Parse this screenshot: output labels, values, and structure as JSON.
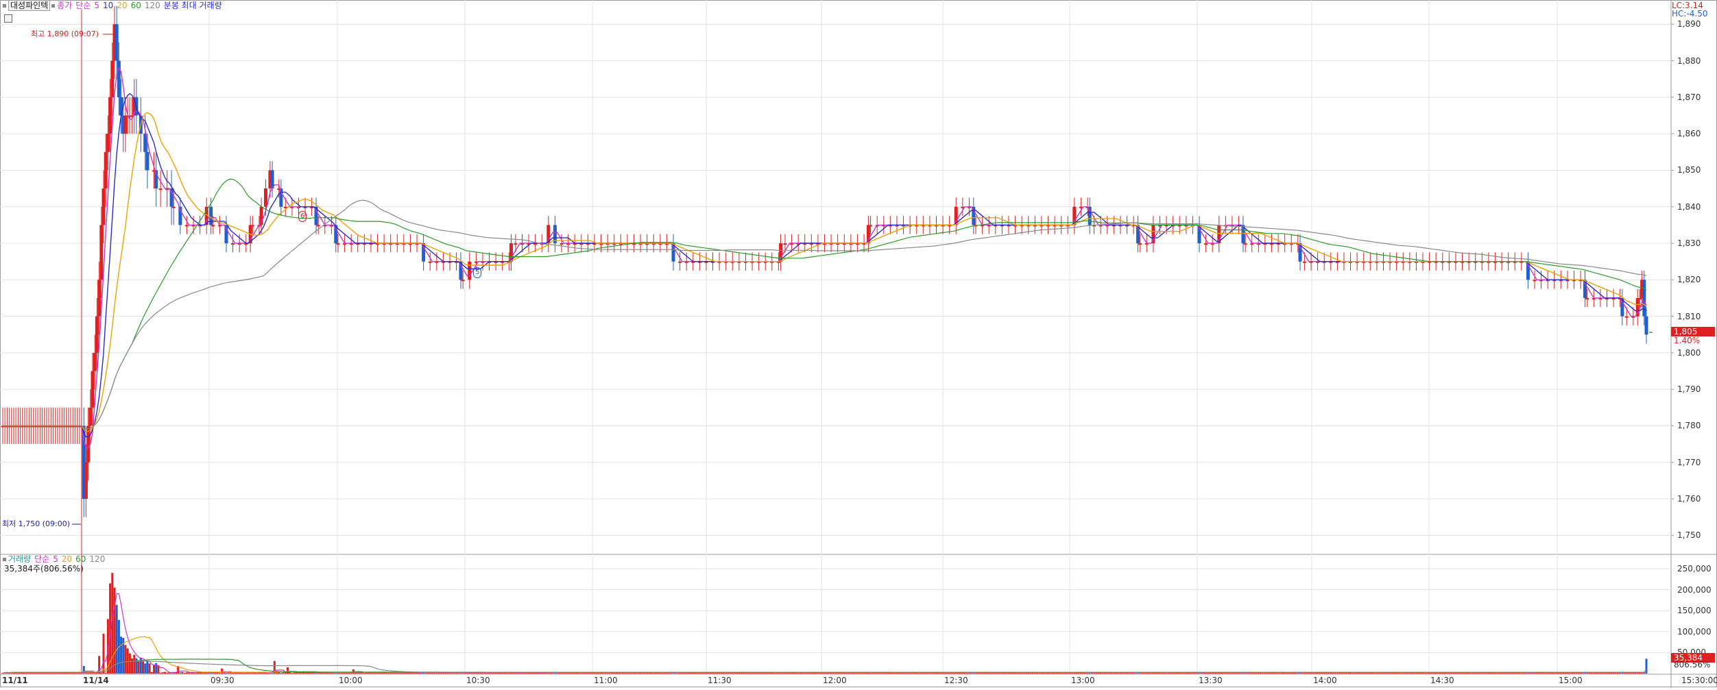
{
  "window": {
    "title": "대성파인텍",
    "legend_price": [
      {
        "label": "종가",
        "color": "#cc33cc"
      },
      {
        "label": "단순",
        "color": "#cc33cc"
      },
      {
        "label": "5",
        "color": "#cc33cc"
      },
      {
        "label": "10",
        "color": "#2a2ad0"
      },
      {
        "label": "20",
        "color": "#f0a000"
      },
      {
        "label": "60",
        "color": "#2a9a2a"
      },
      {
        "label": "120",
        "color": "#888888"
      },
      {
        "label": "분봉 최대 거래량",
        "color": "#2a2ad0"
      }
    ],
    "legend_volume": [
      {
        "label": "거래량",
        "color": "#2a9a9a"
      },
      {
        "label": "단순",
        "color": "#cc33cc"
      },
      {
        "label": "5",
        "color": "#cc33cc"
      },
      {
        "label": "20",
        "color": "#f0a000"
      },
      {
        "label": "60",
        "color": "#2a9a2a"
      },
      {
        "label": "120",
        "color": "#888888"
      }
    ],
    "volume_readout": "35,384주(806.56%)",
    "lc_label": "LC:3.14",
    "hc_label": "HC:-4.50"
  },
  "annotations": {
    "high": "최고 1,890 (09:07)",
    "low": "최저 1,750 (09:00)",
    "marker_5": "5",
    "marker_6": "6"
  },
  "current": {
    "price_label": "1,805",
    "pct_label": "1.40%",
    "volume_label": "35,384",
    "volume_pct_label": "806.56%"
  },
  "colors": {
    "up": "#e02020",
    "down": "#1f5fd0",
    "ma5": "#cc33cc",
    "ma10": "#2a2ad0",
    "ma20": "#f0a000",
    "ma60": "#2a9a2a",
    "ma120": "#888888",
    "grid": "#e3e3e3"
  },
  "chart_data": [
    {
      "type": "candlestick",
      "y_ticks": [
        "1,890",
        "1,880",
        "1,870",
        "1,860",
        "1,850",
        "1,840",
        "1,830",
        "1,820",
        "1,810",
        "1,800",
        "1,790",
        "1,780",
        "1,770",
        "1,760",
        "1,750"
      ],
      "ylim": [
        1745,
        1894
      ],
      "x_ticks": [
        "11/11",
        "11/14",
        "09:30",
        "10:00",
        "10:30",
        "11:00",
        "11:30",
        "12:00",
        "12:30",
        "13:00",
        "13:30",
        "14:00",
        "14:30",
        "15:00",
        "15:30:00"
      ],
      "series_names": [
        "5",
        "10",
        "20",
        "60",
        "120"
      ],
      "price_path": [
        [
          0,
          1780
        ],
        [
          10,
          1778
        ],
        [
          20,
          1780
        ],
        [
          30,
          1780
        ],
        [
          36,
          1779
        ],
        [
          37,
          1760
        ],
        [
          38,
          1770
        ],
        [
          40,
          1785
        ],
        [
          42,
          1800
        ],
        [
          44,
          1820
        ],
        [
          46,
          1845
        ],
        [
          48,
          1860
        ],
        [
          49,
          1870
        ],
        [
          50,
          1880
        ],
        [
          51,
          1890
        ],
        [
          53,
          1870
        ],
        [
          55,
          1860
        ],
        [
          57,
          1865
        ],
        [
          60,
          1868
        ],
        [
          63,
          1862
        ],
        [
          66,
          1850
        ],
        [
          70,
          1847
        ],
        [
          74,
          1845
        ],
        [
          78,
          1840
        ],
        [
          82,
          1836
        ],
        [
          86,
          1835
        ],
        [
          90,
          1836
        ],
        [
          94,
          1838
        ],
        [
          98,
          1835
        ],
        [
          102,
          1832
        ],
        [
          106,
          1831
        ],
        [
          110,
          1831
        ],
        [
          114,
          1833
        ],
        [
          118,
          1838
        ],
        [
          122,
          1848
        ],
        [
          126,
          1843
        ],
        [
          130,
          1840
        ],
        [
          134,
          1838
        ],
        [
          138,
          1840
        ],
        [
          142,
          1838
        ],
        [
          146,
          1834
        ],
        [
          150,
          1833
        ],
        [
          160,
          1829
        ],
        [
          170,
          1828
        ],
        [
          180,
          1828
        ],
        [
          190,
          1828
        ],
        [
          200,
          1825
        ],
        [
          210,
          1822
        ],
        [
          220,
          1824
        ],
        [
          230,
          1827
        ],
        [
          240,
          1830
        ],
        [
          250,
          1833
        ],
        [
          260,
          1830
        ],
        [
          270,
          1829
        ],
        [
          280,
          1829
        ],
        [
          290,
          1828
        ],
        [
          300,
          1828
        ],
        [
          310,
          1827
        ],
        [
          320,
          1823
        ],
        [
          330,
          1823
        ],
        [
          340,
          1824
        ],
        [
          350,
          1827
        ],
        [
          360,
          1828
        ],
        [
          370,
          1828
        ],
        [
          380,
          1830
        ],
        [
          390,
          1832
        ],
        [
          400,
          1833
        ],
        [
          410,
          1837
        ],
        [
          420,
          1836
        ],
        [
          430,
          1837
        ],
        [
          440,
          1838
        ],
        [
          450,
          1836
        ],
        [
          460,
          1834
        ],
        [
          470,
          1834
        ],
        [
          480,
          1835
        ],
        [
          490,
          1838
        ],
        [
          500,
          1837
        ],
        [
          510,
          1834
        ],
        [
          520,
          1832
        ],
        [
          530,
          1833
        ],
        [
          540,
          1833
        ],
        [
          550,
          1832
        ],
        [
          560,
          1833
        ],
        [
          570,
          1832
        ],
        [
          580,
          1829
        ],
        [
          590,
          1828
        ],
        [
          600,
          1824
        ],
        [
          610,
          1824
        ],
        [
          620,
          1825
        ],
        [
          630,
          1825
        ],
        [
          640,
          1823
        ],
        [
          650,
          1823
        ],
        [
          660,
          1825
        ],
        [
          670,
          1827
        ],
        [
          680,
          1826
        ],
        [
          690,
          1823
        ],
        [
          700,
          1822
        ],
        [
          710,
          1820
        ],
        [
          720,
          1818
        ],
        [
          730,
          1815
        ],
        [
          740,
          1812
        ],
        [
          745,
          1811
        ],
        [
          748,
          1818
        ],
        [
          749,
          1812
        ],
        [
          750,
          1805
        ]
      ]
    },
    {
      "type": "bar",
      "name": "거래량",
      "y_ticks": [
        "250,000",
        "200,000",
        "150,000",
        "100,000",
        "50,000"
      ],
      "ylim": [
        0,
        250000
      ],
      "peak_volumes": [
        [
          37,
          18000
        ],
        [
          44,
          42000
        ],
        [
          46,
          95000
        ],
        [
          48,
          130000
        ],
        [
          49,
          215000
        ],
        [
          50,
          240000
        ],
        [
          51,
          205000
        ],
        [
          52,
          160000
        ],
        [
          53,
          110000
        ],
        [
          55,
          85000
        ],
        [
          57,
          60000
        ],
        [
          60,
          45000
        ],
        [
          63,
          38000
        ],
        [
          66,
          30000
        ],
        [
          70,
          25000
        ],
        [
          80,
          18000
        ],
        [
          100,
          12000
        ],
        [
          124,
          30000
        ],
        [
          130,
          15000
        ],
        [
          160,
          10000
        ],
        [
          750,
          35384
        ]
      ]
    }
  ]
}
